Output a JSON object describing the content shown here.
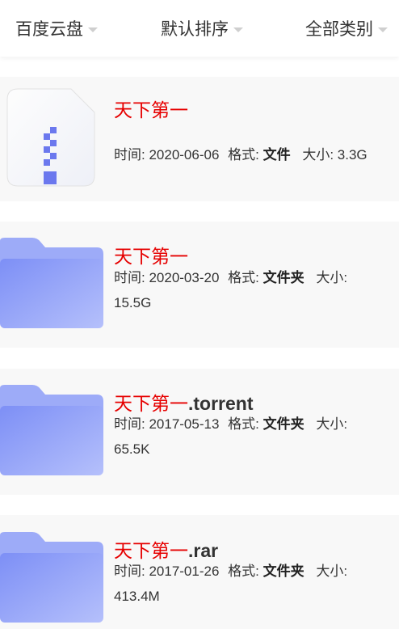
{
  "filters": [
    {
      "label": "百度云盘"
    },
    {
      "label": "默认排序"
    },
    {
      "label": "全部类别"
    }
  ],
  "labels": {
    "time": "时间: ",
    "format": "格式: ",
    "size": "大小: "
  },
  "results": [
    {
      "title_highlight": "天下第一",
      "title_rest": "",
      "date": "2020-06-06",
      "format": "文件",
      "size": "3.3G",
      "icon": "zip-file-icon"
    },
    {
      "title_highlight": "天下第一",
      "title_rest": "",
      "date": "2020-03-20",
      "format": "文件夹",
      "size": "15.5G",
      "icon": "folder-icon"
    },
    {
      "title_highlight": "天下第一",
      "title_rest": ".torrent",
      "date": "2017-05-13",
      "format": "文件夹",
      "size": "65.5K",
      "icon": "folder-icon"
    },
    {
      "title_highlight": "天下第一",
      "title_rest": ".rar",
      "date": "2017-01-26",
      "format": "文件夹",
      "size": "413.4M",
      "icon": "folder-icon"
    }
  ],
  "colors": {
    "highlight": "#e60000",
    "folder": "#8a9bf7",
    "card_bg": "#f8f8f8"
  }
}
